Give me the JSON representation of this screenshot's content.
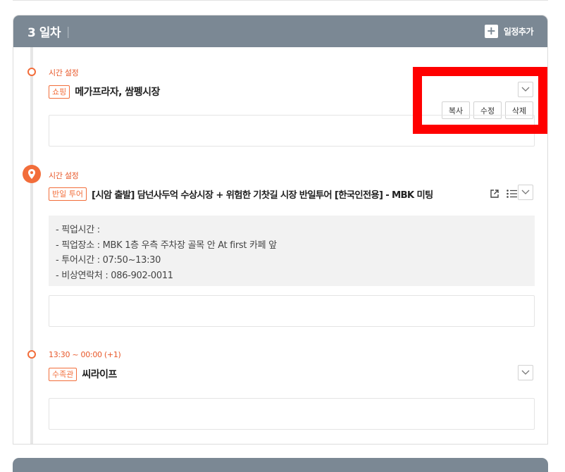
{
  "day": {
    "title": "3 일차",
    "separator": "|",
    "add_icon": "plus-icon",
    "add_label": "일정추가",
    "header_color": "#7b8894",
    "accent_color": "#f26d3a"
  },
  "items": [
    {
      "time": "시간 설정",
      "tag": "쇼핑",
      "title": "메가프라자, 쌈펭시장",
      "marker_icon": "timeline-dot-icon",
      "chevron_icon": "chevron-down-icon",
      "actions": {
        "copy": "복사",
        "edit": "수정",
        "delete": "삭제"
      }
    },
    {
      "time": "시간 설정",
      "tag": "반일 투어",
      "title": "[시암 출발] 담넌사두억 수상시장 + 위험한 기찻길 시장 반일투어 [한국인전용] - MBK 미팅",
      "marker_icon": "map-pin-icon",
      "details": [
        "- 픽업시간 :",
        "- 픽업장소 : MBK 1층 우측 주차장 골목 안 At first 카페 앞",
        "- 투어시간 : 07:50~13:30",
        "- 비상연락처 : 086-902-0011"
      ]
    },
    {
      "time": "13:30 ~ 00:00 (+1)",
      "tag": "수족관",
      "title": "씨라이프",
      "marker_icon": "timeline-dot-icon"
    }
  ]
}
